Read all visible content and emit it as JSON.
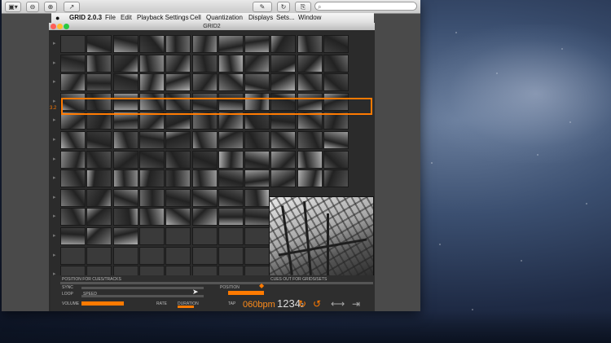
{
  "desktop": {
    "background": "starry-sky"
  },
  "toolbar": {
    "sidebar_btn": "▣▾",
    "zoom_out": "⊖",
    "zoom_in": "⊕",
    "share": "↗",
    "annotate": "✎",
    "rotate": "↻",
    "edit": "⎘",
    "search_placeholder": ""
  },
  "menubar": {
    "app_name": "GRID 2.0.3",
    "items": [
      "File",
      "Edit",
      "Playback Settings",
      "Cell",
      "Quantization",
      "Displays",
      "Sets...",
      "Window"
    ]
  },
  "window": {
    "title": "GRID2"
  },
  "grid": {
    "rows": [
      "▸",
      "▸",
      "▸",
      "▸",
      "▸",
      "▸",
      "▸",
      "▸",
      "▸",
      "▸",
      "▸"
    ],
    "selected_row_label": "3.2"
  },
  "controls": {
    "position_for_label": "POSITION FOR CUES/TRACKS",
    "cue_label": "CUES OUT FOR GRIDS/SETS",
    "sync_label": "SYNC",
    "loop_label": "LOOP",
    "speed_label": "SPEED",
    "position_label": "POSITION",
    "tap_label": "TAP",
    "volume_label": "VOLUME",
    "rate_label": "RATE",
    "duration_label": "DURATION",
    "bpm": "060bpm",
    "counter": "1234",
    "counter_sub": "2",
    "colors": {
      "accent": "#ff7a00",
      "highlight": "#3cff3c"
    }
  }
}
